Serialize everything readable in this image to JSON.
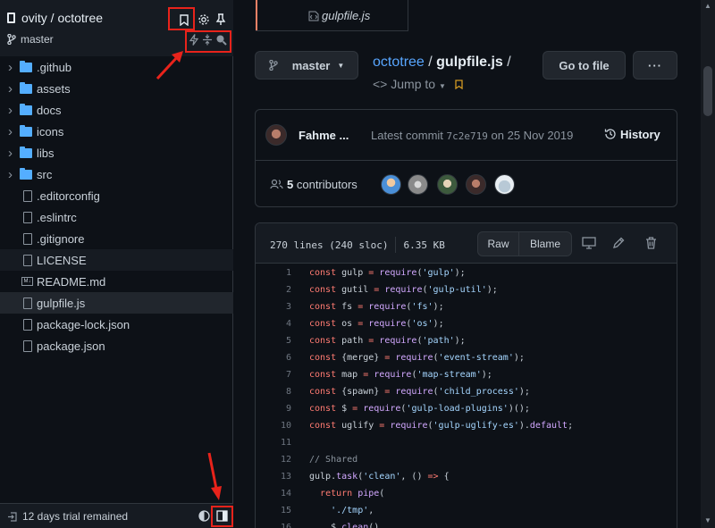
{
  "sidebar": {
    "repo_title": "ovity / octotree",
    "branch": "master",
    "tree": [
      {
        "type": "folder",
        "label": ".github"
      },
      {
        "type": "folder",
        "label": "assets"
      },
      {
        "type": "folder",
        "label": "docs"
      },
      {
        "type": "folder",
        "label": "icons"
      },
      {
        "type": "folder",
        "label": "libs"
      },
      {
        "type": "folder",
        "label": "src"
      },
      {
        "type": "file",
        "label": ".editorconfig"
      },
      {
        "type": "file",
        "label": ".eslintrc"
      },
      {
        "type": "file",
        "label": ".gitignore"
      },
      {
        "type": "file",
        "label": "LICENSE",
        "state": "hover"
      },
      {
        "type": "md",
        "label": "README.md"
      },
      {
        "type": "file",
        "label": "gulpfile.js",
        "state": "active"
      },
      {
        "type": "file",
        "label": "package-lock.json"
      },
      {
        "type": "file",
        "label": "package.json"
      }
    ],
    "footer_text": "12 days trial remained"
  },
  "tab": {
    "label": "gulpfile.js"
  },
  "toolbar": {
    "branch_label": "master",
    "crumb_repo": "octotree",
    "crumb_sep": " / ",
    "crumb_file": "gulpfile.js",
    "crumb_trailing": " /",
    "jump_label": "Jump to",
    "go_to_file": "Go to file",
    "more_label": "···"
  },
  "commit": {
    "author": "Fahme ...",
    "latest_prefix": "Latest commit",
    "hash": "7c2e719",
    "date_text": "on 25 Nov 2019",
    "history_label": "History",
    "contributors_count": "5",
    "contributors_label": "contributors"
  },
  "file": {
    "lines_info": "270 lines (240 sloc)",
    "size": "6.35 KB",
    "raw_label": "Raw",
    "blame_label": "Blame"
  },
  "code": [
    {
      "n": "1",
      "t": "const gulp = require('gulp');"
    },
    {
      "n": "2",
      "t": "const gutil = require('gulp-util');"
    },
    {
      "n": "3",
      "t": "const fs = require('fs');"
    },
    {
      "n": "4",
      "t": "const os = require('os');"
    },
    {
      "n": "5",
      "t": "const path = require('path');"
    },
    {
      "n": "6",
      "t": "const {merge} = require('event-stream');"
    },
    {
      "n": "7",
      "t": "const map = require('map-stream');"
    },
    {
      "n": "8",
      "t": "const {spawn} = require('child_process');"
    },
    {
      "n": "9",
      "t": "const $ = require('gulp-load-plugins')();"
    },
    {
      "n": "10",
      "t": "const uglify = require('gulp-uglify-es').default;"
    },
    {
      "n": "11",
      "t": ""
    },
    {
      "n": "12",
      "t": "// Shared"
    },
    {
      "n": "13",
      "t": "gulp.task('clean', () => {"
    },
    {
      "n": "14",
      "t": "  return pipe("
    },
    {
      "n": "15",
      "t": "    './tmp',"
    },
    {
      "n": "16",
      "t": "    $.clean()"
    }
  ],
  "colors": {
    "annotation_red": "#e8231b",
    "link_blue": "#58a6ff",
    "keyword": "#ff7b72",
    "string": "#a5d6ff",
    "comment": "#8b949e",
    "function": "#d2a8ff"
  }
}
